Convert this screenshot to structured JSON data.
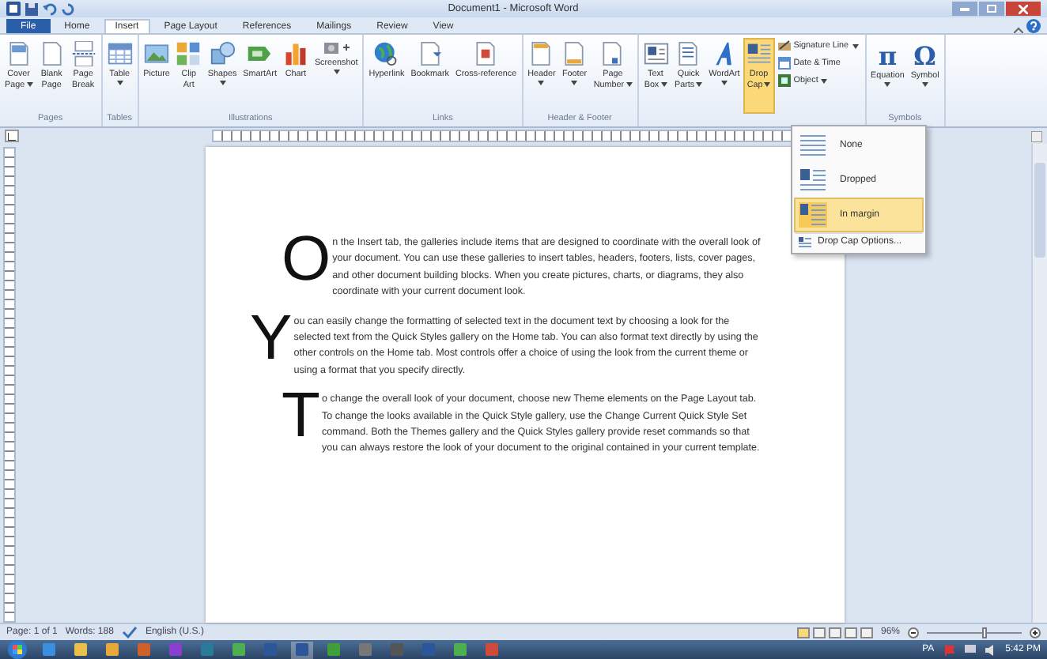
{
  "window": {
    "title": "Document1 - Microsoft Word"
  },
  "tabs": [
    {
      "label": "File",
      "kind": "backstage",
      "selected": false
    },
    {
      "label": "Home",
      "kind": "tab",
      "selected": false
    },
    {
      "label": "Insert",
      "kind": "tab",
      "selected": true
    },
    {
      "label": "Page Layout",
      "kind": "tab",
      "selected": false
    },
    {
      "label": "References",
      "kind": "tab",
      "selected": false
    },
    {
      "label": "Mailings",
      "kind": "tab",
      "selected": false
    },
    {
      "label": "Review",
      "kind": "tab",
      "selected": false
    },
    {
      "label": "View",
      "kind": "tab",
      "selected": false
    }
  ],
  "ribbon": {
    "groups": [
      {
        "label": "Pages",
        "buttons": [
          {
            "lines": [
              "Cover",
              "Page"
            ],
            "dropdown": true,
            "selected": false
          },
          {
            "lines": [
              "Blank",
              "Page"
            ],
            "dropdown": false,
            "selected": false
          },
          {
            "lines": [
              "Page",
              "Break"
            ],
            "dropdown": false,
            "selected": false
          }
        ]
      },
      {
        "label": "Tables",
        "buttons": [
          {
            "lines": [
              "Table"
            ],
            "dropdown": true,
            "selected": false
          }
        ]
      },
      {
        "label": "Illustrations",
        "buttons": [
          {
            "lines": [
              "Picture"
            ],
            "dropdown": false,
            "selected": false
          },
          {
            "lines": [
              "Clip",
              "Art"
            ],
            "dropdown": false,
            "selected": false
          },
          {
            "lines": [
              "Shapes"
            ],
            "dropdown": true,
            "selected": false
          },
          {
            "lines": [
              "SmartArt"
            ],
            "dropdown": false,
            "selected": false
          },
          {
            "lines": [
              "Chart"
            ],
            "dropdown": false,
            "selected": false
          },
          {
            "lines": [
              "Screenshot"
            ],
            "dropdown": true,
            "selected": false
          }
        ]
      },
      {
        "label": "Links",
        "buttons": [
          {
            "lines": [
              "Hyperlink"
            ],
            "dropdown": false,
            "selected": false
          },
          {
            "lines": [
              "Bookmark"
            ],
            "dropdown": false,
            "selected": false
          },
          {
            "lines": [
              "Cross-reference"
            ],
            "dropdown": false,
            "selected": false
          }
        ]
      },
      {
        "label": "Header & Footer",
        "buttons": [
          {
            "lines": [
              "Header"
            ],
            "dropdown": true,
            "selected": false
          },
          {
            "lines": [
              "Footer"
            ],
            "dropdown": true,
            "selected": false
          },
          {
            "lines": [
              "Page",
              "Number"
            ],
            "dropdown": true,
            "selected": false
          }
        ]
      },
      {
        "buttons": [
          {
            "lines": [
              "Text",
              "Box"
            ],
            "dropdown": true,
            "selected": false
          },
          {
            "lines": [
              "Quick",
              "Parts"
            ],
            "dropdown": true,
            "selected": false
          },
          {
            "lines": [
              "WordArt"
            ],
            "dropdown": true,
            "selected": false
          },
          {
            "lines": [
              "Drop",
              "Cap"
            ],
            "dropdown": true,
            "selected": true
          }
        ],
        "small_buttons": [
          {
            "label": "Signature Line",
            "dropdown": true
          },
          {
            "label": "Date & Time",
            "dropdown": false
          },
          {
            "label": "Object",
            "dropdown": true
          }
        ]
      },
      {
        "label": "Symbols",
        "buttons": [
          {
            "glyph": "π",
            "lines": [
              "Equation"
            ],
            "dropdown": true,
            "selected": false
          },
          {
            "glyph": "Ω",
            "lines": [
              "Symbol"
            ],
            "dropdown": true,
            "selected": false
          }
        ]
      }
    ]
  },
  "drop_cap_menu": {
    "items": [
      {
        "label": "None",
        "kind": "none",
        "selected": false
      },
      {
        "label": "Dropped",
        "kind": "dropped",
        "selected": false
      },
      {
        "label": "In margin",
        "kind": "margin",
        "selected": true
      }
    ],
    "options": "Drop Cap Options..."
  },
  "document": {
    "paragraphs": [
      {
        "drop_cap": "O",
        "kind": "dropped",
        "text": "n the Insert tab, the galleries include items that are designed to coordinate with the overall look of your document. You can use these galleries to insert tables, headers, footers, lists, cover pages, and other document building blocks. When you create pictures, charts, or diagrams, they also coordinate with your current document look."
      },
      {
        "drop_cap": "Y",
        "kind": "margin",
        "text": "ou can easily change the formatting of selected text in the document text by choosing a look for the selected text from the Quick Styles gallery on the Home tab. You can also format text directly by using the other controls on the Home tab. Most controls offer a choice of using the look from the current theme or using a format that you specify directly."
      },
      {
        "drop_cap": "T",
        "kind": "dropped",
        "text": "o change the overall look of your document, choose new Theme elements on the Page Layout tab. To change the looks available in the Quick Style gallery, use the Change Current Quick Style Set command. Both the Themes gallery and the Quick Styles gallery provide reset commands so that you can always restore the look of your document to the original contained in your current template."
      }
    ]
  },
  "status_bar": {
    "page": "Page: 1 of 1",
    "words": "Words: 188",
    "language": "English (U.S.)",
    "zoom": "96%",
    "zoom_slider": {
      "level": 0.6
    }
  },
  "taskbar": {
    "language": "PA",
    "clock": "5:42 PM"
  }
}
